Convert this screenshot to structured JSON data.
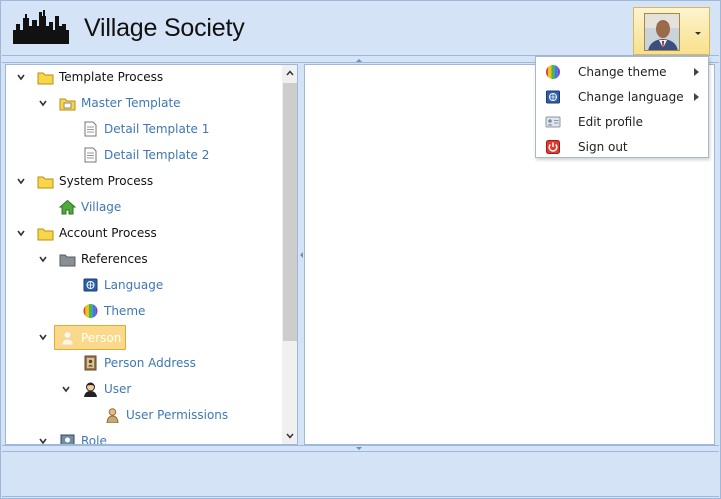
{
  "app": {
    "title": "Village Society"
  },
  "menu": {
    "items": [
      {
        "label": "Change theme",
        "icon": "theme-icon",
        "has_submenu": true
      },
      {
        "label": "Change language",
        "icon": "language-icon",
        "has_submenu": true
      },
      {
        "label": "Edit profile",
        "icon": "edit-profile-icon",
        "has_submenu": false
      },
      {
        "label": "Sign out",
        "icon": "power-icon",
        "has_submenu": false
      }
    ]
  },
  "tree": {
    "nodes": [
      {
        "label": "Template Process"
      },
      {
        "label": "Master Template"
      },
      {
        "label": "Detail Template 1"
      },
      {
        "label": "Detail Template 2"
      },
      {
        "label": "System Process"
      },
      {
        "label": "Village"
      },
      {
        "label": "Account Process"
      },
      {
        "label": "References"
      },
      {
        "label": "Language"
      },
      {
        "label": "Theme"
      },
      {
        "label": "Person",
        "selected": true
      },
      {
        "label": "Person Address"
      },
      {
        "label": "User"
      },
      {
        "label": "User Permissions"
      },
      {
        "label": "Role"
      }
    ]
  },
  "colors": {
    "chrome": "#d4e3f6",
    "border": "#9fb7d8",
    "link": "#3d77b5",
    "selected_bg": "#fbd98a"
  }
}
